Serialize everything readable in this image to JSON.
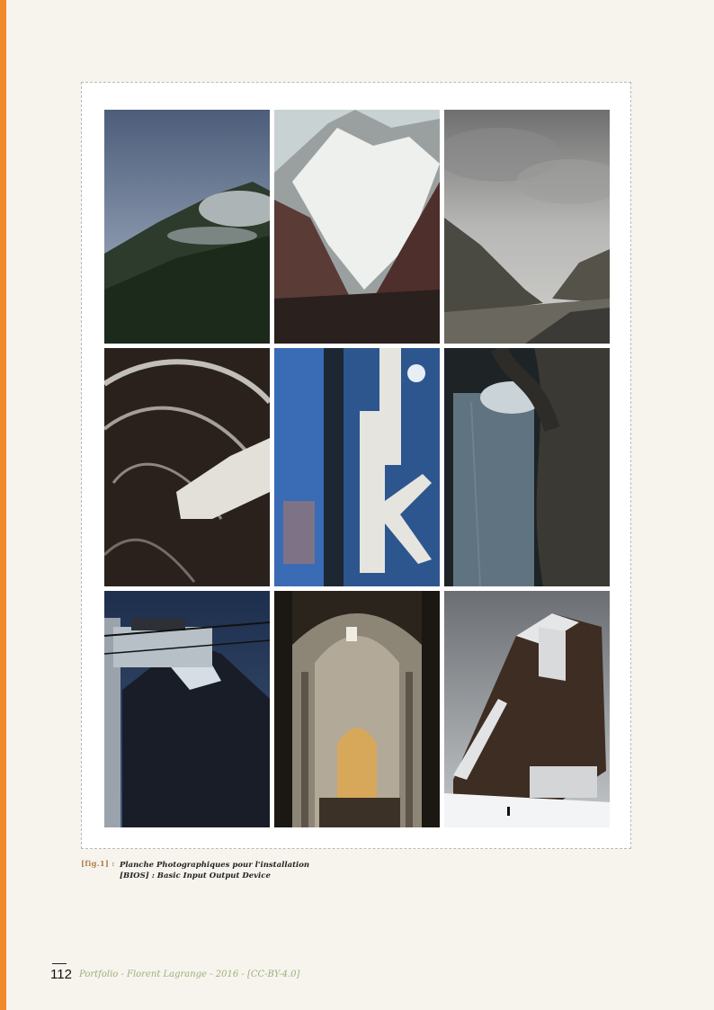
{
  "plate": {
    "photos": [
      {
        "name": "misty-forest-mountain-photo"
      },
      {
        "name": "snowy-peak-painting-photo"
      },
      {
        "name": "cloudy-valley-photo"
      },
      {
        "name": "soapy-window-cleaning-photo"
      },
      {
        "name": "blue-letters-metal-photo"
      },
      {
        "name": "dark-tree-trunk-photo"
      },
      {
        "name": "cable-car-mountain-photo"
      },
      {
        "name": "cathedral-nave-photo"
      },
      {
        "name": "snowy-wooden-building-photo"
      }
    ]
  },
  "caption": {
    "label": "[fig.1] :",
    "line1": "Planche Photographiques pour l'installation",
    "line2": "[BIOS] : Basic Input Output Device"
  },
  "footer": {
    "page_number": "112",
    "text": "Portfolio - Florent Lagrange - 2016 - [CC-BY-4.0]"
  },
  "colors": {
    "accent": "#f0892a",
    "page_background": "#f7f4ee",
    "footer_text": "#9bb07a",
    "caption_label": "#b0824f"
  }
}
